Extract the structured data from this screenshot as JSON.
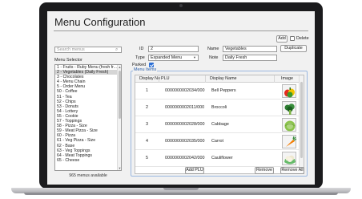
{
  "window": {
    "title": "Menu Configuration"
  },
  "toolbar": {
    "add_label": "Add",
    "delete_label": "Delete",
    "delete_checked": false
  },
  "search": {
    "placeholder": "Search menus"
  },
  "menu_selector": {
    "label": "Menu Selector",
    "items": [
      {
        "label": "1 - Fruits - Ruby Menu (fresh fr...",
        "selected": false
      },
      {
        "label": "2 - Vegetables (Daily Fresh)",
        "selected": true
      },
      {
        "label": "3 - Chocolates",
        "selected": false
      },
      {
        "label": "4 - Menu Chain",
        "selected": false
      },
      {
        "label": "5 - Order Menu",
        "selected": false
      },
      {
        "label": "50 - Coffee",
        "selected": false
      },
      {
        "label": "51 - Tea",
        "selected": false
      },
      {
        "label": "52 - Chips",
        "selected": false
      },
      {
        "label": "53 - Donuts",
        "selected": false
      },
      {
        "label": "54 - Lottery",
        "selected": false
      },
      {
        "label": "55 - Cookie",
        "selected": false
      },
      {
        "label": "57 - Toppings",
        "selected": false
      },
      {
        "label": "58 - Pizza - Size",
        "selected": false
      },
      {
        "label": "59 - Meat Pizza - Size",
        "selected": false
      },
      {
        "label": "60 - Pizza",
        "selected": false
      },
      {
        "label": "61 - Veg Pizza - Size",
        "selected": false
      },
      {
        "label": "62 - Base",
        "selected": false
      },
      {
        "label": "63 - Veg Toppings",
        "selected": false
      },
      {
        "label": "64 - Meat Toppings",
        "selected": false
      },
      {
        "label": "65 - Cheese",
        "selected": false
      }
    ],
    "count_text": "965 menus available"
  },
  "form": {
    "id_label": "ID",
    "id_value": "2",
    "name_label": "Name",
    "name_value": "Vegetables",
    "duplicate_label": "Duplicate",
    "type_label": "Type",
    "type_value": "Expanded Menu",
    "note_label": "Note",
    "note_value": "Daily Fresh",
    "parked_label": "Parked",
    "parked_checked": true
  },
  "menu_items": {
    "legend": "Menu Items",
    "columns": [
      "Display No",
      "PLU",
      "Display Name",
      "Image"
    ],
    "rows": [
      {
        "display_no": "1",
        "plu": "0000000002034/000",
        "name": "Bell Peppers",
        "image_icon": "bell-pepper-icon"
      },
      {
        "display_no": "2",
        "plu": "0000000002011/000",
        "name": "Broccoli",
        "image_icon": "broccoli-icon"
      },
      {
        "display_no": "3",
        "plu": "0000000002028/000",
        "name": "Cabbage",
        "image_icon": "cabbage-icon"
      },
      {
        "display_no": "4",
        "plu": "0000000002035/000",
        "name": "Carrot",
        "image_icon": "carrot-icon"
      },
      {
        "display_no": "5",
        "plu": "0000000002042/000",
        "name": "Cauliflower",
        "image_icon": "cauliflower-icon"
      }
    ],
    "add_plu_label": "Add PLU",
    "remove_label": "Remove",
    "remove_all_label": "Remove All"
  }
}
